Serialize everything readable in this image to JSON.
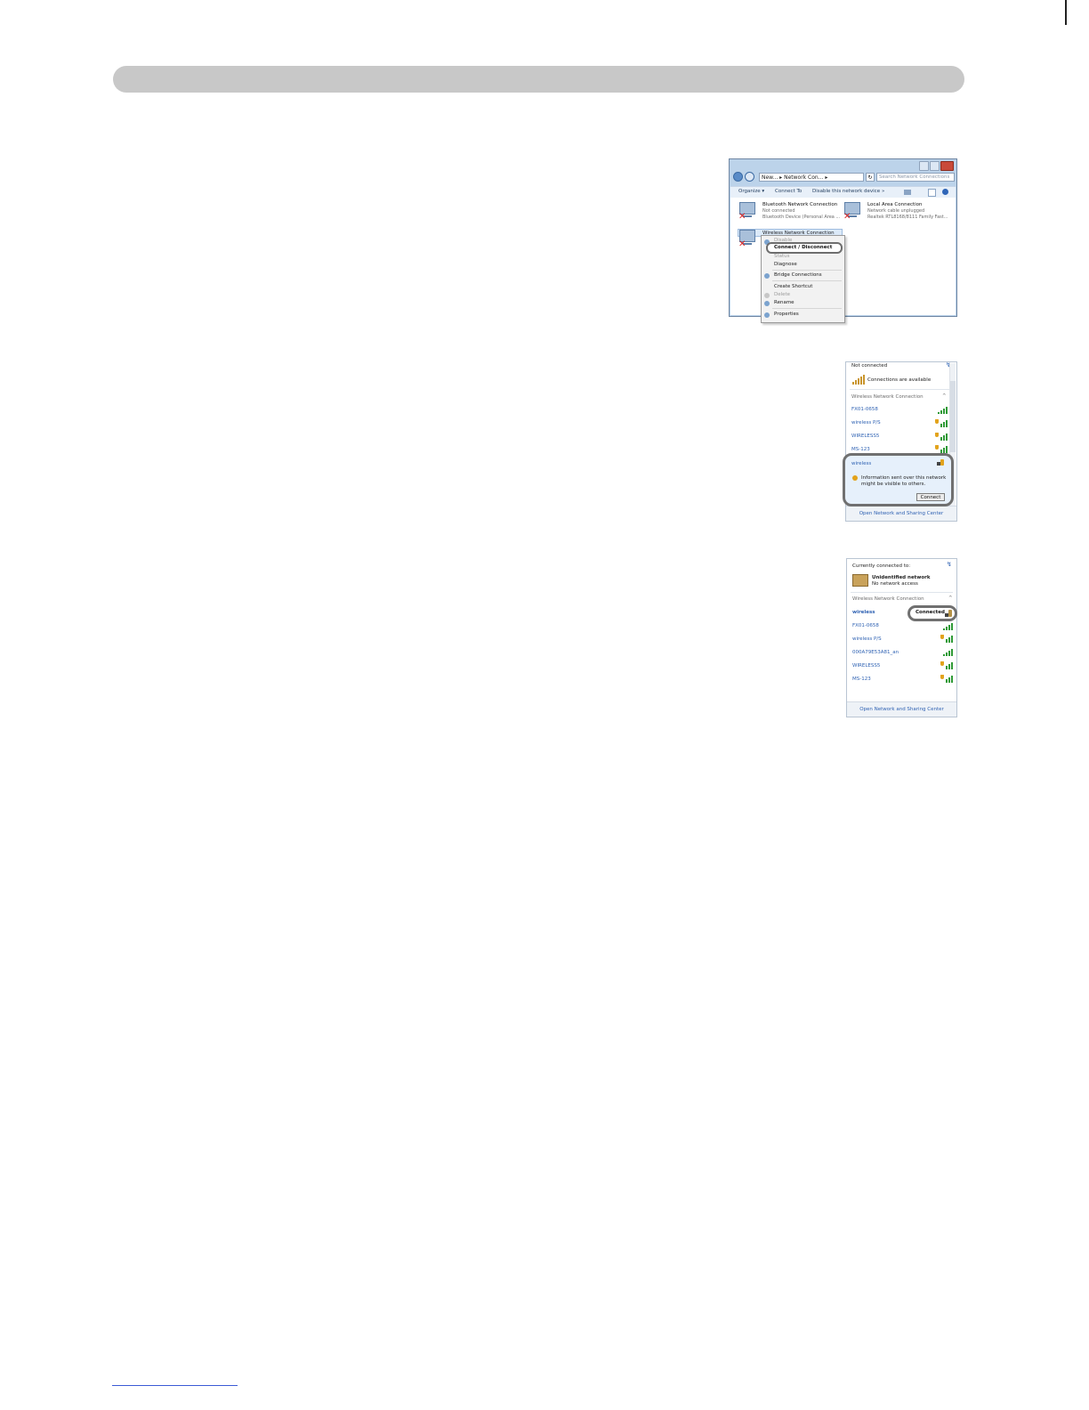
{
  "explorer": {
    "address": "New... ▸ Network Con... ▸",
    "search_placeholder": "Search Network Connections",
    "toolbar": {
      "organize": "Organize ▾",
      "connect_to": "Connect To",
      "disable": "Disable this network device",
      "more": "»"
    },
    "connections": [
      {
        "title": "Bluetooth Network Connection",
        "line1": "Not connected",
        "line2": "Bluetooth Device (Personal Area ..."
      },
      {
        "title": "Local Area Connection",
        "line1": "Network cable unplugged",
        "line2": "Realtek RTL8168/8111 Family Fast..."
      },
      {
        "title": "Wireless Network Connection"
      }
    ],
    "context_menu": {
      "disable": "Disable",
      "connect_disconnect": "Connect / Disconnect",
      "status": "Status",
      "diagnose": "Diagnose",
      "bridge": "Bridge Connections",
      "create_shortcut": "Create Shortcut",
      "delete": "Delete",
      "rename": "Rename",
      "properties": "Properties"
    }
  },
  "wifi_list": {
    "status": "Not connected",
    "available": "Connections are available",
    "section": "Wireless Network Connection",
    "networks": [
      "FX01-0658",
      "wireless P/S",
      "WIRELESS5",
      "MS-123"
    ],
    "selected": {
      "name": "wireless",
      "warning_line1": "Information sent over this network",
      "warning_line2": "might be visible to others.",
      "button": "Connect"
    },
    "footer": "Open Network and Sharing Center"
  },
  "wifi_connected": {
    "heading": "Currently connected to:",
    "network": "Unidentified network",
    "access": "No network access",
    "section": "Wireless Network Connection",
    "connected_name": "wireless",
    "connected_label": "Connected",
    "networks": [
      "FX01-0658",
      "wireless P/S",
      "000A79E53A81_an",
      "WIRELESS5",
      "MS-123"
    ],
    "footer": "Open Network and Sharing Center"
  },
  "colors": {
    "header_bar": "#c8c8c8",
    "highlight_outline": "#707070",
    "link": "#2f62b3",
    "signal_green": "#2e9a36"
  }
}
